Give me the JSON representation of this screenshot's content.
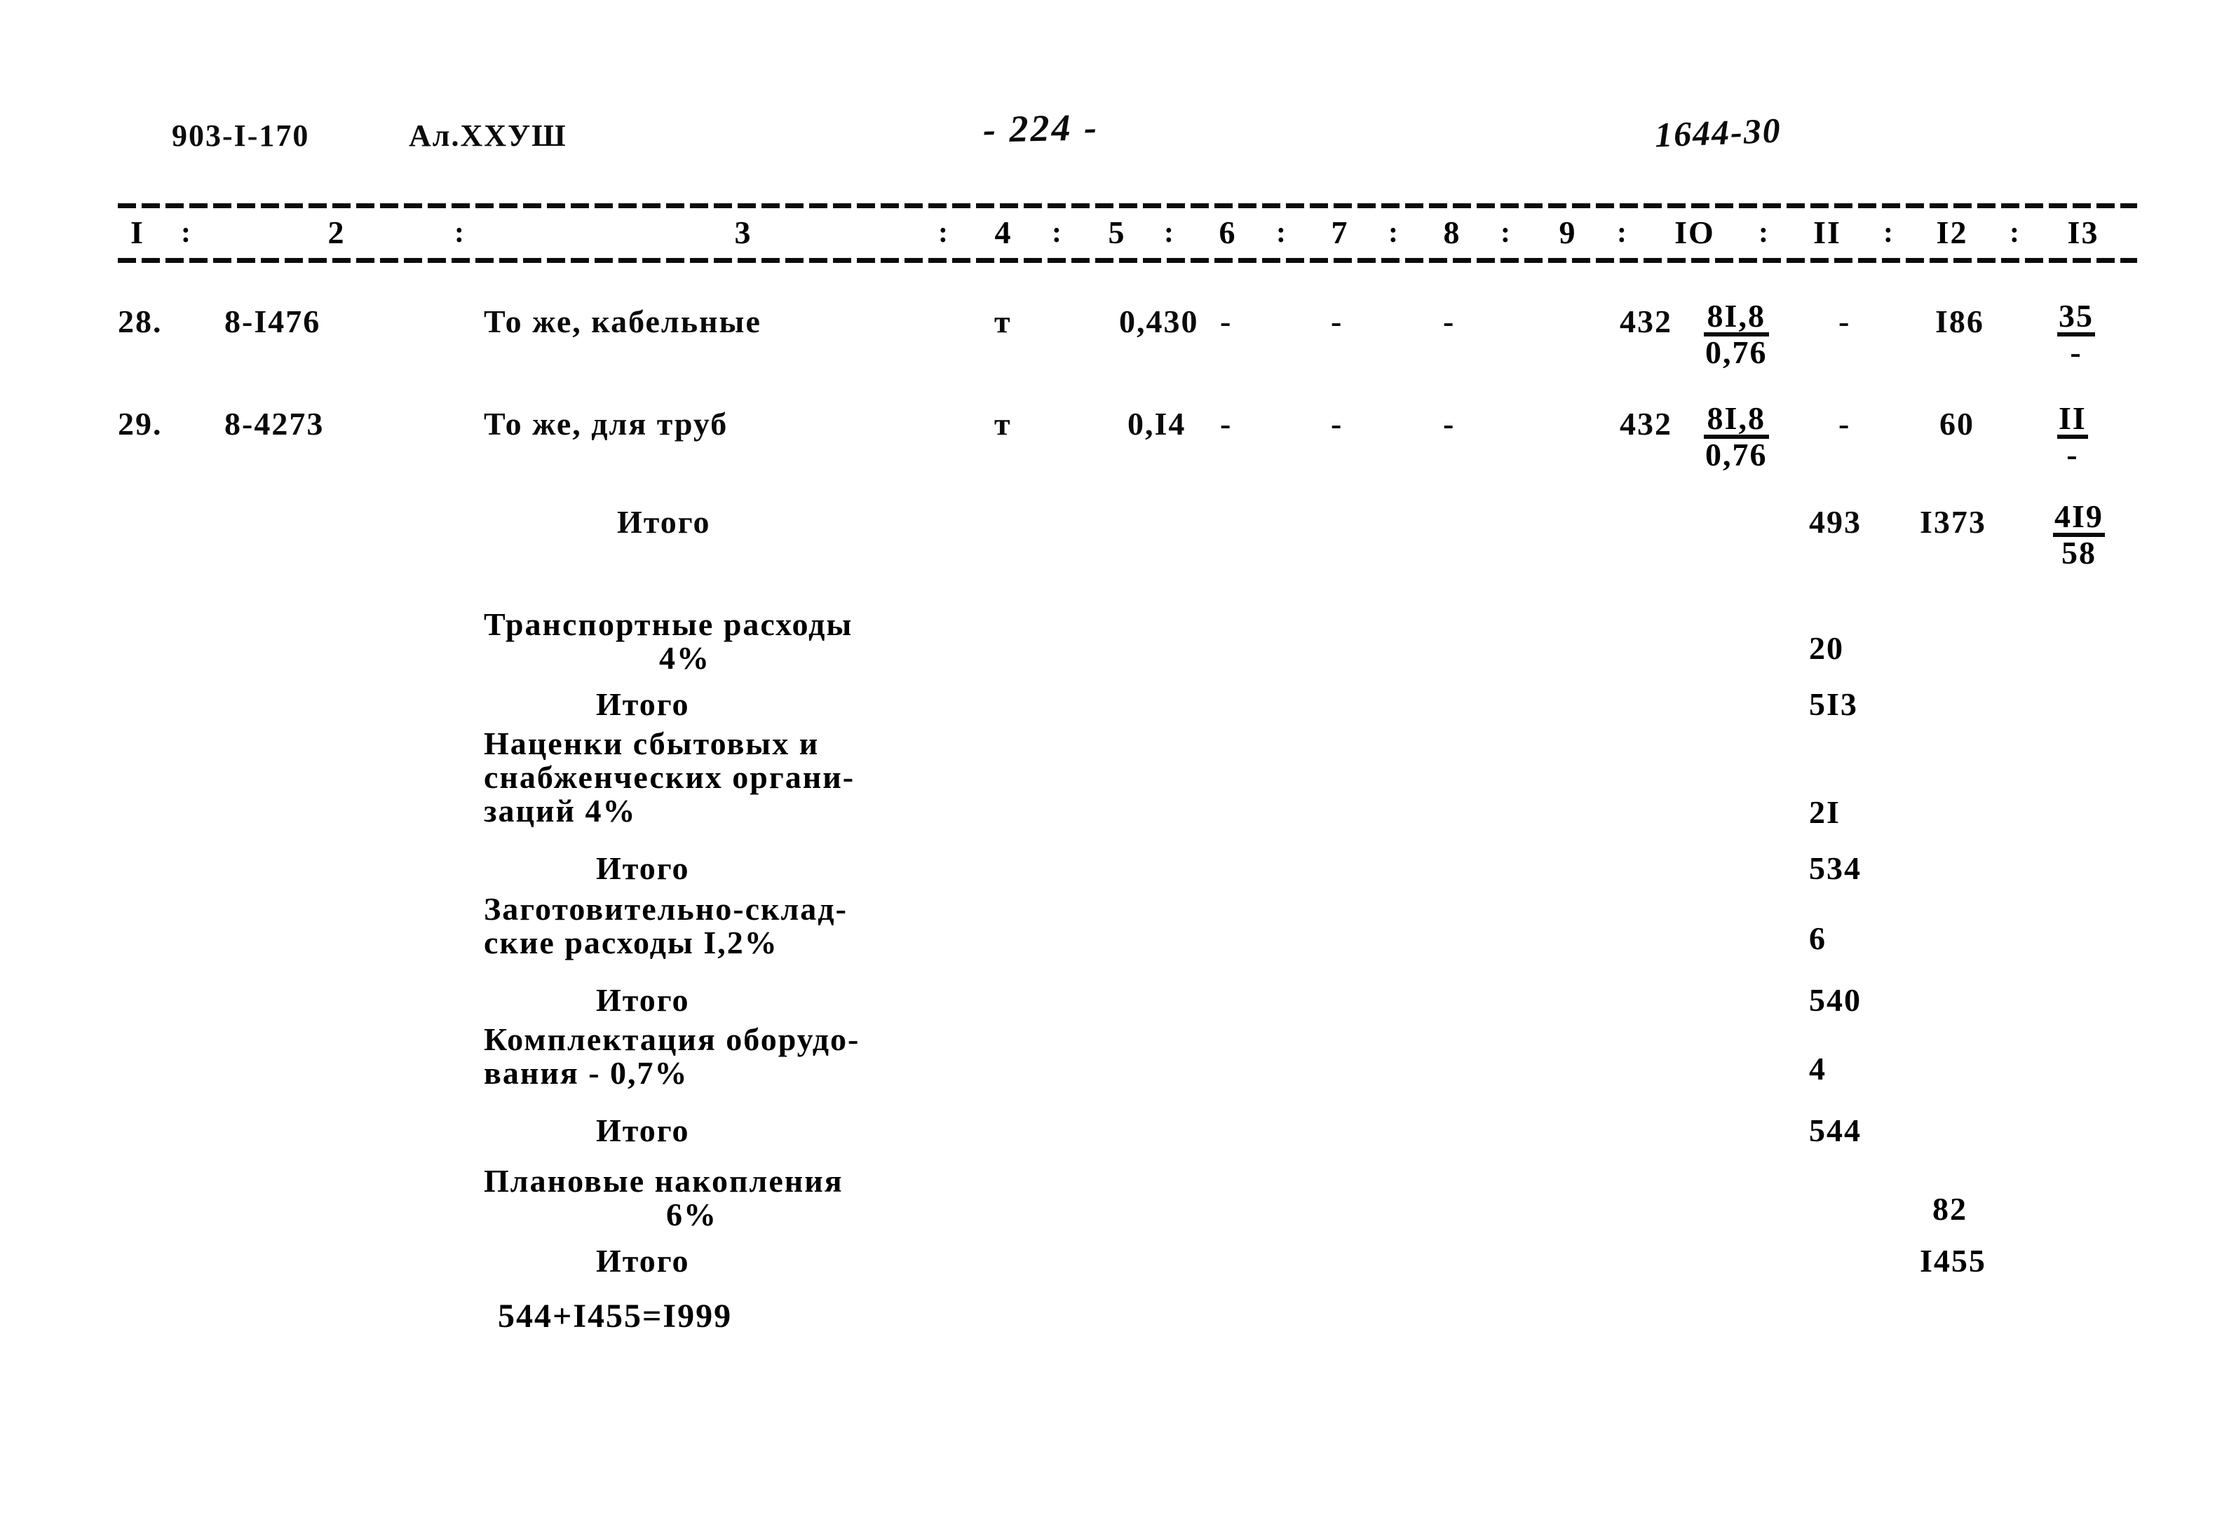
{
  "document": {
    "header": {
      "project_code": "903-I-170",
      "album": "Ал.XXУШ",
      "page_number": "- 224 -",
      "stamp_right": "1644-30"
    },
    "table": {
      "column_headers": [
        "I",
        "2",
        "3",
        "4",
        "5",
        "6",
        "7",
        "8",
        "9",
        "IO",
        "II",
        "I2",
        "I3"
      ],
      "separator": ":",
      "rows": [
        {
          "num": "28.",
          "code": "8-I476",
          "description": "То же, кабельные",
          "unit": "т",
          "c5": "0,430",
          "c6": "-",
          "c7": "-",
          "c8": "-",
          "c9": "-",
          "c10": "432",
          "c11_num": "8I,8",
          "c11_den": "0,76",
          "c12": "-",
          "c13": "I86",
          "c14_num": "35",
          "c14_den": "-"
        },
        {
          "num": "29.",
          "code": "8-4273",
          "description": "То же, для труб",
          "unit": "т",
          "c5": "0,I4",
          "c6": "-",
          "c7": "-",
          "c8": "-",
          "c9": "-",
          "c10": "432",
          "c11_num": "8I,8",
          "c11_den": "0,76",
          "c12": "-",
          "c13": "60",
          "c14_num": "II",
          "c14_den": "-"
        }
      ],
      "totals_row": {
        "label": "Итого",
        "c11": "493",
        "c12": "I373",
        "c13_num": "4I9",
        "c13_den": "58"
      }
    },
    "summary": {
      "items": [
        {
          "label_line1": "Транспортные расходы",
          "label_line2": "",
          "label_line3": "",
          "percent": "4%",
          "value": "20",
          "total_label": "Итого",
          "total_value": "5I3"
        },
        {
          "label_line1": "Наценки сбытовых и",
          "label_line2": "снабженческих органи-",
          "label_line3": "заций 4%",
          "percent": "",
          "value": "2I",
          "total_label": "Итого",
          "total_value": "534"
        },
        {
          "label_line1": "Заготовительно-склад-",
          "label_line2": "ские расходы I,2%",
          "label_line3": "",
          "percent": "",
          "value": "6",
          "total_label": "Итого",
          "total_value": "540"
        },
        {
          "label_line1": "Комплектация оборудо-",
          "label_line2": "вания - 0,7%",
          "label_line3": "",
          "percent": "",
          "value": "4",
          "total_label": "Итого",
          "total_value": "544"
        },
        {
          "label_line1": "Плановые накопления",
          "label_line2": "",
          "label_line3": "",
          "percent": "6%",
          "value": "82",
          "total_label": "Итого",
          "total_value": "I455"
        }
      ],
      "grand_total": "544+I455=I999"
    },
    "colors": {
      "ink": "#0b0b0b",
      "paper": "#ffffff"
    }
  }
}
